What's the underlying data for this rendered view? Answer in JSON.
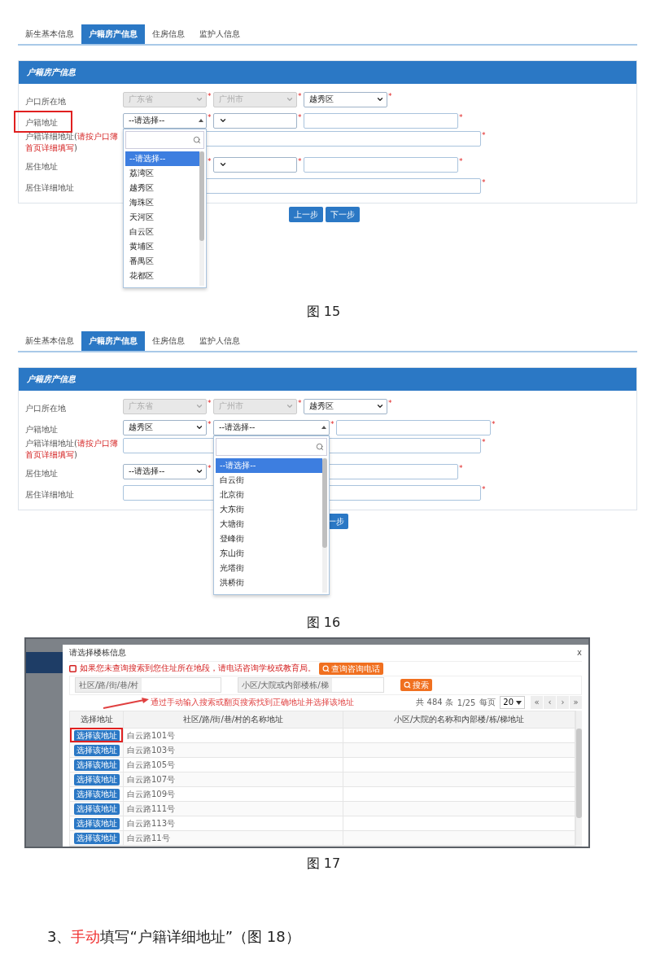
{
  "figures": [
    {
      "kind": "form",
      "caption": "图 15",
      "tabs": [
        {
          "label": "新生基本信息",
          "selected": false
        },
        {
          "label": "户籍房产信息",
          "selected": true
        },
        {
          "label": "住房信息",
          "selected": false
        },
        {
          "label": "监护人信息",
          "selected": false
        }
      ],
      "panel_title": "户籍房产信息",
      "rows": [
        {
          "label": "户口所在地",
          "highlighted": false,
          "controls": [
            {
              "kind": "select",
              "value": "广东省",
              "disabled": true,
              "open": false,
              "mark": "*"
            },
            {
              "kind": "select",
              "value": "广州市",
              "disabled": true,
              "open": false,
              "mark": "*"
            },
            {
              "kind": "select",
              "value": "越秀区",
              "disabled": false,
              "open": false,
              "mark": "*"
            }
          ]
        },
        {
          "label": "户籍地址",
          "highlighted": true,
          "controls": [
            {
              "kind": "select",
              "value": "--请选择--",
              "disabled": false,
              "open": true,
              "mark": "*",
              "options": [
                {
                  "label": "--请选择--",
                  "selected": true
                },
                {
                  "label": "荔湾区",
                  "selected": false
                },
                {
                  "label": "越秀区",
                  "selected": false
                },
                {
                  "label": "海珠区",
                  "selected": false
                },
                {
                  "label": "天河区",
                  "selected": false
                },
                {
                  "label": "白云区",
                  "selected": false
                },
                {
                  "label": "黄埔区",
                  "selected": false
                },
                {
                  "label": "番禺区",
                  "selected": false
                },
                {
                  "label": "花都区",
                  "selected": false
                }
              ]
            },
            {
              "kind": "select",
              "disabled": false,
              "open": false,
              "mark": "*"
            },
            {
              "kind": "input",
              "mark": "*"
            }
          ]
        },
        {
          "label": "户籍详细地址(",
          "note": "请按户口簿首页详细填写",
          "label_tail": ")",
          "highlighted": false,
          "controls": [
            {
              "kind": "wide-input",
              "mark": "*"
            }
          ]
        },
        {
          "label": "居住地址",
          "highlighted": false,
          "controls": [
            {
              "kind": "covered",
              "mark": "*"
            },
            {
              "kind": "select",
              "disabled": false,
              "open": false,
              "mark": "*"
            },
            {
              "kind": "input",
              "mark": "*"
            }
          ]
        },
        {
          "label": "居住详细地址",
          "highlighted": false,
          "controls": [
            {
              "kind": "wide-input",
              "mark": "*"
            }
          ]
        }
      ],
      "buttons": [
        {
          "label": "上一步",
          "cut": false
        },
        {
          "label": "下一步",
          "cut": false
        }
      ]
    },
    {
      "kind": "form",
      "caption": "图 16",
      "tabs": [
        {
          "label": "新生基本信息",
          "selected": false
        },
        {
          "label": "户籍房产信息",
          "selected": true
        },
        {
          "label": "住房信息",
          "selected": false
        },
        {
          "label": "监护人信息",
          "selected": false
        }
      ],
      "panel_title": "户籍房产信息",
      "rows": [
        {
          "label": "户口所在地",
          "highlighted": false,
          "controls": [
            {
              "kind": "select",
              "value": "广东省",
              "disabled": true,
              "open": false,
              "mark": "*"
            },
            {
              "kind": "select",
              "value": "广州市",
              "disabled": true,
              "open": false,
              "mark": "*"
            },
            {
              "kind": "select",
              "value": "越秀区",
              "disabled": false,
              "open": false,
              "mark": "*"
            }
          ]
        },
        {
          "label": "户籍地址",
          "highlighted": false,
          "controls": [
            {
              "kind": "select",
              "value": "越秀区",
              "disabled": false,
              "open": false,
              "mark": "*"
            },
            {
              "kind": "select",
              "value": "--请选择--",
              "disabled": false,
              "open": true,
              "mark": "*",
              "options": [
                {
                  "label": "--请选择--",
                  "selected": true
                },
                {
                  "label": "白云街",
                  "selected": false
                },
                {
                  "label": "北京街",
                  "selected": false
                },
                {
                  "label": "大东街",
                  "selected": false
                },
                {
                  "label": "大塘街",
                  "selected": false
                },
                {
                  "label": "登峰街",
                  "selected": false
                },
                {
                  "label": "东山街",
                  "selected": false
                },
                {
                  "label": "光塔街",
                  "selected": false
                },
                {
                  "label": "洪桥街",
                  "selected": false
                }
              ]
            },
            {
              "kind": "input",
              "mark": "*"
            }
          ]
        },
        {
          "label": "户籍详细地址(",
          "note": "请按户口簿首页详细填写",
          "label_tail": ")",
          "highlighted": false,
          "controls": [
            {
              "kind": "wide-input",
              "mark": "*"
            }
          ]
        },
        {
          "label": "居住地址",
          "highlighted": false,
          "controls": [
            {
              "kind": "select",
              "value": "--请选择--",
              "disabled": false,
              "open": false,
              "mark": "*"
            },
            {
              "kind": "covered"
            },
            {
              "kind": "input",
              "mark": "*"
            }
          ]
        },
        {
          "label": "居住详细地址",
          "highlighted": false,
          "controls": [
            {
              "kind": "wide-input",
              "mark": "*"
            }
          ]
        }
      ],
      "buttons": [
        {
          "label": "一步",
          "cut": true
        }
      ]
    },
    {
      "kind": "modal",
      "caption": "图 17",
      "title": "请选择楼栋信息",
      "close": "x",
      "notice": "如果您未查询搜索到您住址所在地段，请电话咨询学校或教育局。",
      "notice_button": "查询咨询电话",
      "search_fields": [
        {
          "label": "社区/路/街/巷/村"
        },
        {
          "label": "小区/大院或内部楼栋/梯"
        }
      ],
      "search_button": "搜索",
      "annotation": "通过手动输入搜索或翻页搜索找到正确地址并选择该地址",
      "pager": {
        "total": "共 484 条",
        "page": "1/25",
        "per_page_label": "每页",
        "per_page": "20",
        "nav": [
          "«",
          "‹",
          "›",
          "»"
        ]
      },
      "columns": [
        "选择地址",
        "社区/路/街/巷/村的名称地址",
        "小区/大院的名称和内部楼/栋/梯地址"
      ],
      "rows": [
        {
          "action": "选择该地址",
          "address": "白云路101号",
          "highlighted": true
        },
        {
          "action": "选择该地址",
          "address": "白云路103号",
          "highlighted": false
        },
        {
          "action": "选择该地址",
          "address": "白云路105号",
          "highlighted": false
        },
        {
          "action": "选择该地址",
          "address": "白云路107号",
          "highlighted": false
        },
        {
          "action": "选择该地址",
          "address": "白云路109号",
          "highlighted": false
        },
        {
          "action": "选择该地址",
          "address": "白云路111号",
          "highlighted": false
        },
        {
          "action": "选择该地址",
          "address": "白云路113号",
          "highlighted": false
        },
        {
          "action": "选择该地址",
          "address": "白云路11号",
          "highlighted": false
        }
      ]
    }
  ],
  "instruction": {
    "number": "3、",
    "highlight": "手动",
    "text": "填写“户籍详细地址”（图 18）"
  }
}
